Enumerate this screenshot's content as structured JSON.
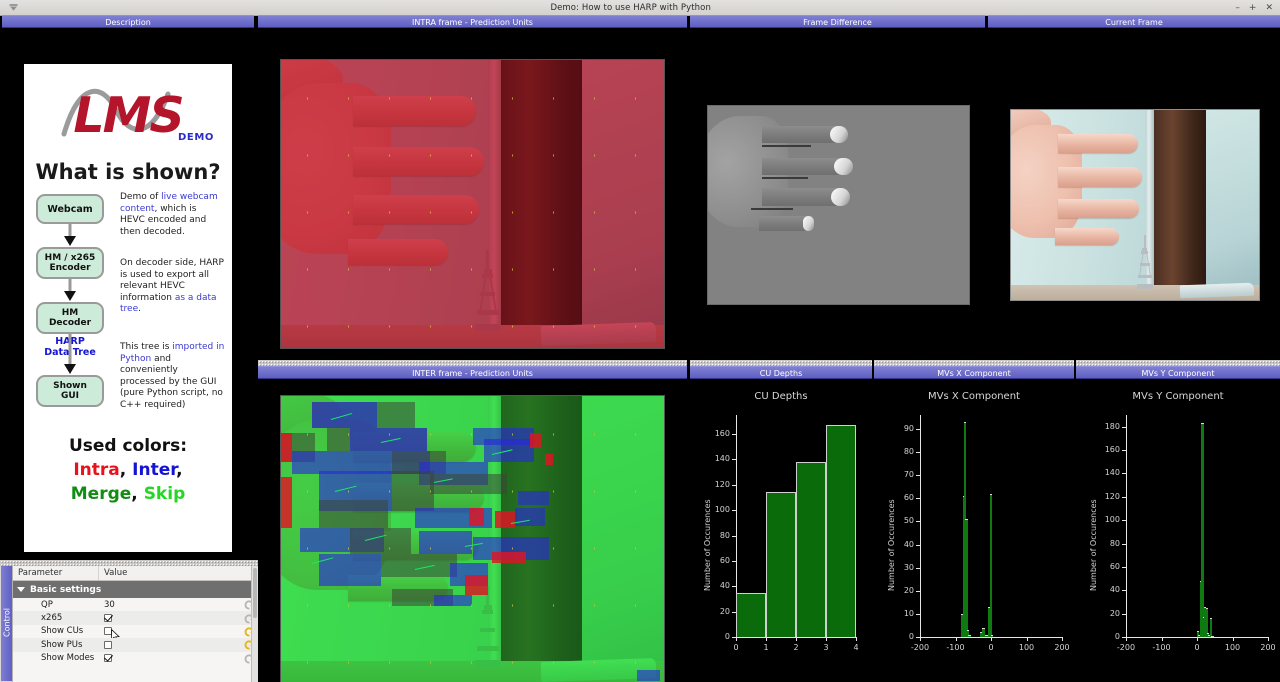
{
  "window": {
    "title": "Demo: How to use HARP with Python",
    "menu_icon": "dropdown-icon",
    "buttons": {
      "minimize": "–",
      "maximize": "+",
      "close": "✕"
    }
  },
  "panels": {
    "description": "Description",
    "intra": "INTRA frame - Prediction Units",
    "frame_difference": "Frame Difference",
    "current_frame": "Current Frame",
    "inter": "INTER frame - Prediction Units",
    "cu_depths": "CU Depths",
    "mvs_x": "MVs X Component",
    "mvs_y": "MVs Y Component"
  },
  "description": {
    "logo_text": "LMS",
    "logo_sub": "DEMO",
    "heading": "What is shown?",
    "nodes": [
      {
        "label_1": "Webcam",
        "label_2": ""
      },
      {
        "label_1": "HM / x265",
        "label_2": "Encoder"
      },
      {
        "label_1": "HM",
        "label_2": "Decoder"
      },
      {
        "label_1": "Shown",
        "label_2": "GUI"
      }
    ],
    "edge_label_1": "HARP",
    "edge_label_2": "Data Tree",
    "paragraphs": [
      {
        "pre": "Demo of ",
        "link": "live webcam content",
        "post": ", which is HEVC encoded and then decoded."
      },
      {
        "pre": "On decoder side, HARP is used to export all relevant HEVC information ",
        "link": "as a data tree",
        "post": "."
      },
      {
        "pre": "This tree is ",
        "link": "imported in Python",
        "post": " and conveniently processed by the GUI (pure Python script, no C++ required)"
      }
    ],
    "colors_heading": "Used colors:",
    "color_terms": [
      {
        "text": "Intra",
        "color": "#e8121c"
      },
      {
        "text": "Inter",
        "color": "#1414d2"
      },
      {
        "text": "Merge",
        "color": "#138c13"
      },
      {
        "text": "Skip",
        "color": "#25d625"
      }
    ],
    "link_color": "#3a3ad2"
  },
  "control": {
    "tab_label": "Control",
    "columns": [
      "Parameter",
      "Value"
    ],
    "group": "Basic settings",
    "rows": [
      {
        "name": "QP",
        "type": "text",
        "value": "30",
        "reset_active": false
      },
      {
        "name": "x265",
        "type": "checkbox",
        "checked": true,
        "reset_active": false
      },
      {
        "name": "Show CUs",
        "type": "checkbox",
        "checked": false,
        "reset_active": true
      },
      {
        "name": "Show PUs",
        "type": "checkbox",
        "checked": false,
        "reset_active": true
      },
      {
        "name": "Show Modes",
        "type": "checkbox",
        "checked": true,
        "reset_active": false
      }
    ]
  },
  "chart_data": [
    {
      "id": "cu_depths",
      "type": "bar",
      "title": "CU Depths",
      "xlabel": "",
      "ylabel": "Number of Occurences",
      "categories": [
        "0",
        "1",
        "2",
        "3",
        "4"
      ],
      "bin_edges": [
        0,
        1,
        2,
        3,
        4
      ],
      "values": [
        35,
        114,
        138,
        167
      ],
      "xlim": [
        0,
        4
      ],
      "ylim": [
        0,
        175
      ],
      "yticks": [
        0,
        20,
        40,
        60,
        80,
        100,
        120,
        140,
        160
      ],
      "xticks": [
        0,
        1,
        2,
        3,
        4
      ],
      "bar_color": "#0a6b0a",
      "edge_color": "#cfcfcf",
      "grid": false,
      "legend": "none"
    },
    {
      "id": "mvs_x",
      "type": "bar",
      "title": "MVs X Component",
      "xlabel": "",
      "ylabel": "Number of Occurences",
      "x": [
        -180,
        -100,
        -84,
        -80,
        -76,
        -72,
        -68,
        -64,
        -40,
        -32,
        -24,
        -16,
        -8,
        -4,
        0,
        4,
        40,
        100,
        180
      ],
      "values": [
        0,
        0,
        10,
        61,
        93,
        51,
        3,
        1,
        0,
        2,
        4,
        1,
        13,
        62,
        1,
        0,
        0,
        0,
        0
      ],
      "xlim": [
        -200,
        200
      ],
      "ylim": [
        0,
        96
      ],
      "yticks": [
        0,
        10,
        20,
        30,
        40,
        50,
        60,
        70,
        80,
        90
      ],
      "xticks": [
        -200,
        -100,
        0,
        100,
        200
      ],
      "bar_color": "#0f7a12",
      "edge_color": "#d8d8d8",
      "grid": false,
      "legend": "none"
    },
    {
      "id": "mvs_y",
      "type": "bar",
      "title": "MVs Y Component",
      "xlabel": "",
      "ylabel": "Number of Occurences",
      "x": [
        -180,
        -100,
        0,
        4,
        8,
        12,
        16,
        20,
        24,
        28,
        32,
        36,
        40,
        100,
        180
      ],
      "values": [
        0,
        0,
        5,
        2,
        48,
        183,
        17,
        26,
        25,
        3,
        2,
        16,
        1,
        0,
        0
      ],
      "xlim": [
        -200,
        200
      ],
      "ylim": [
        0,
        190
      ],
      "yticks": [
        0,
        20,
        40,
        60,
        80,
        100,
        120,
        140,
        160,
        180
      ],
      "xticks": [
        -200,
        -100,
        0,
        100,
        200
      ],
      "bar_color": "#0f7a12",
      "edge_color": "#d8d8d8",
      "grid": false,
      "legend": "none"
    }
  ]
}
